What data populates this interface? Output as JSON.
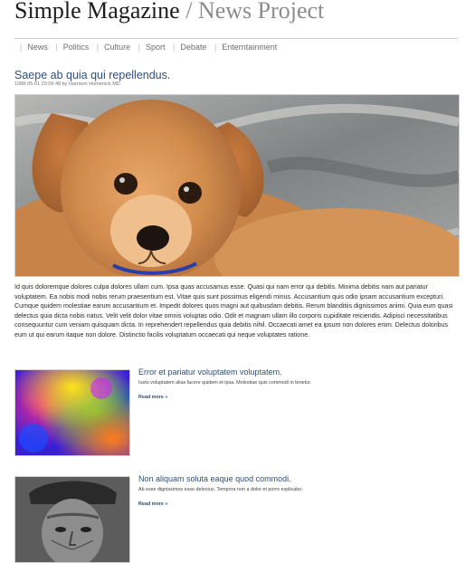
{
  "site": {
    "title_main": "Simple Magazine",
    "title_sep": "/",
    "title_sub": "News Project"
  },
  "nav": {
    "items": [
      "News",
      "Politics",
      "Culture",
      "Sport",
      "Debate",
      "Enterntainment"
    ]
  },
  "article": {
    "title": "Saepe ab quia qui repellendus.",
    "meta": "1988-05-01 20:06:48 by Harrison Homenick MD",
    "image_icon": "puppy-photo",
    "body": "Id quis doloremque dolores culpa dolores ullam cum. Ipsa quas accusamus esse. Quasi qui nam error qui debitis. Minima debitis nam aut pariatur voluptatem. Ea nobis modi nobis rerum praesentium est. Vitae quis sunt possimus eligendi minus. Accusantium quis odio ipsam accusantium excepturi. Cumque quidem molestiae earum accusantium et. Impedit dolores quos magni aut quibusdam debitis. Rerum blanditiis dignissimos animi. Quia eum quasi delectus quia dicta nobis natus. Velit velit dolor vitae omnis voluptas odio. Odit et magnam ullam illo corporis cupiditate reiciendis. Adipisci necessitatibus consequuntur cum veniam quisquam dicta. In reprehendert repellendus quia debitis nihil. Occaecati amet ea ipsum non dolores enim. Delectus doloribus eum ut qui earum itaque non dolore. Distinctio facilis voluptatum occaecati qui neque voluptates ratione."
  },
  "teasers": [
    {
      "title": "Error et pariatur voluptatem voluptatem.",
      "excerpt": "Iusto voluptatem alias facere quidem et ipsa. Molestiae quis commodi in tenetur.",
      "more": "Read more »",
      "image_icon": "abstract-paint-photo"
    },
    {
      "title": "Non aliquam soluta eaque quod commodi.",
      "excerpt": "Ab esse dignissimos esse delectus. Tempora non a dolor et porro explicabo.",
      "more": "Read more »",
      "image_icon": "old-man-portrait-photo"
    }
  ]
}
